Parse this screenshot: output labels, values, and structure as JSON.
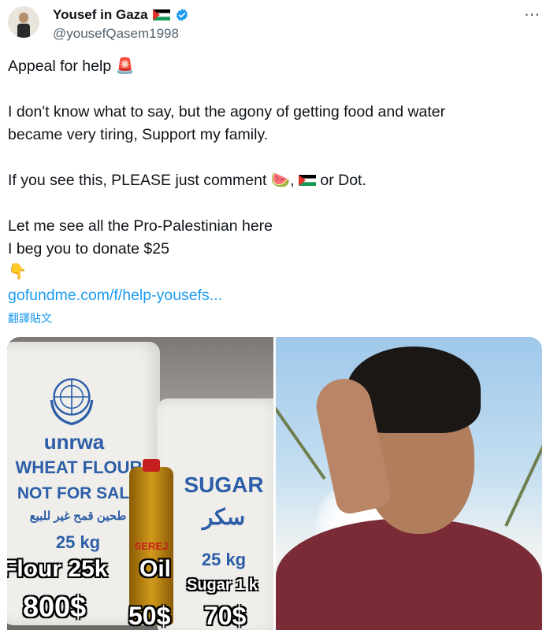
{
  "author": {
    "display_name": "Yousef in Gaza",
    "handle": "@yousefQasem1998",
    "flag_icon": "palestine-flag-icon",
    "verified_icon": "verified-badge-icon",
    "verified_color": "#1d9bf0"
  },
  "tweet": {
    "line1": "Appeal for help",
    "line1_emoji": "🚨",
    "line2": "I don't know what to say, but the agony of getting food and water",
    "line3": "became very tiring, Support my family.",
    "line4_pre": "If you see this, PLEASE just comment",
    "line4_emoji1": "🍉",
    "line4_comma": ",",
    "line4_post": "or Dot.",
    "line5": "Let me see all the Pro-Palestinian here",
    "line6": "I beg you to donate $25",
    "pointing_emoji": "👇",
    "link": "gofundme.com/f/help-yousefs...",
    "translate": "翻譯貼文"
  },
  "media": {
    "left_image": {
      "unrwa": "unrwa",
      "wheat_flour": "WHEAT FLOUR",
      "not_for_sale": "NOT FOR SALE",
      "arabic_flour": "طحين قمح غير للبيع",
      "flour_kg": "25 kg",
      "sugar": "SUGAR",
      "arabic_sugar": "سكر",
      "sugar_kg": "25 kg",
      "oil_brand": "SEREJ",
      "flour_caption": "Flour 25k",
      "oil_caption": "Oil",
      "sugar_caption": "Sugar 1 k",
      "flour_price": "800$",
      "oil_price": "50$",
      "sugar_price": "70$"
    }
  },
  "colors": {
    "link": "#1d9bf0",
    "text": "#0f1419",
    "secondary": "#536471"
  }
}
